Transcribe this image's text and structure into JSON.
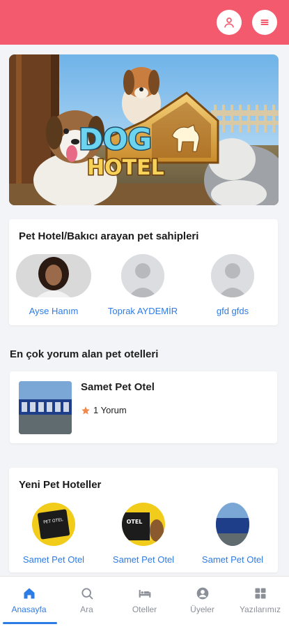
{
  "header": {
    "user_icon": "user-icon",
    "menu_icon": "menu-icon",
    "bg_color": "#f45a6e"
  },
  "hero": {
    "logo_line1": "DOG",
    "logo_line2": "HOTEL"
  },
  "owners_section": {
    "title": "Pet Hotel/Bakıcı arayan pet sahipleri",
    "owners": [
      {
        "name": "Ayse Hanım"
      },
      {
        "name": "Toprak AYDEMİR"
      },
      {
        "name": "gfd gfds"
      }
    ]
  },
  "top_reviewed": {
    "title": "En çok yorum alan pet otelleri",
    "hotels": [
      {
        "name": "Samet Pet Otel",
        "reviews": "1 Yorum"
      }
    ]
  },
  "new_hotels": {
    "title": "Yeni Pet Hoteller",
    "hotels": [
      {
        "name": "Samet Pet Otel",
        "sign": "PET OTEL"
      },
      {
        "name": "Samet Pet Otel",
        "sign": "OTEL"
      },
      {
        "name": "Samet Pet Otel",
        "sign": ""
      }
    ]
  },
  "bottom_nav": {
    "items": [
      {
        "label": "Anasayfa",
        "icon": "home-icon",
        "active": true
      },
      {
        "label": "Ara",
        "icon": "search-icon",
        "active": false
      },
      {
        "label": "Oteller",
        "icon": "bed-icon",
        "active": false
      },
      {
        "label": "Üyeler",
        "icon": "user-circle-icon",
        "active": false
      },
      {
        "label": "Yazılarımız",
        "icon": "grid-icon",
        "active": false
      }
    ]
  },
  "colors": {
    "accent": "#2d7be5",
    "brand": "#f45a6e",
    "star": "#f08a4b"
  }
}
